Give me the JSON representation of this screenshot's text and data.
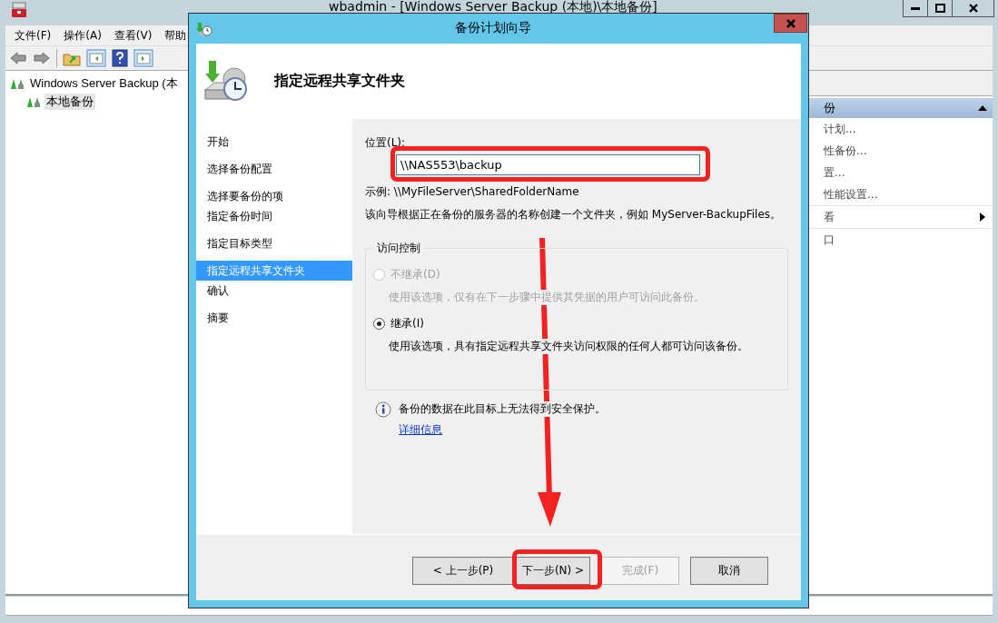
{
  "main_window": {
    "title": "wbadmin - [Windows Server Backup (本地)\\本地备份]",
    "menu": [
      "文件(F)",
      "操作(A)",
      "查看(V)",
      "帮助"
    ],
    "tree": [
      {
        "label": "Windows Server Backup (本",
        "selected": false,
        "children": [
          {
            "label": "本地备份",
            "selected": true
          }
        ]
      }
    ],
    "actions": {
      "header": "份",
      "items": [
        {
          "label": "计划...",
          "kind": "action"
        },
        {
          "label": "性备份...",
          "kind": "action"
        },
        {
          "label": "置...",
          "kind": "action"
        },
        {
          "label": "性能设置...",
          "kind": "action"
        },
        {
          "label": "看",
          "kind": "submenu"
        },
        {
          "label": "口",
          "kind": "action"
        }
      ]
    }
  },
  "dialog": {
    "title": "备份计划向导",
    "heading": "指定远程共享文件夹",
    "steps": [
      {
        "label": "开始",
        "selected": false
      },
      {
        "label": "选择备份配置",
        "selected": false
      },
      {
        "label": "选择要备份的项",
        "selected": false
      },
      {
        "label": "指定备份时间",
        "selected": false
      },
      {
        "label": "指定目标类型",
        "selected": false
      },
      {
        "label": "指定远程共享文件夹",
        "selected": true
      },
      {
        "label": "确认",
        "selected": false
      },
      {
        "label": "摘要",
        "selected": false
      }
    ],
    "location": {
      "label": "位置(L):",
      "value": "\\\\NAS553\\backup"
    },
    "example": "示例: \\\\MyFileServer\\SharedFolderName",
    "description": "该向导根据正在备份的服务器的名称创建一个文件夹，例如 MyServer-BackupFiles。",
    "access_control": {
      "legend": "访问控制",
      "options": [
        {
          "label": "不继承(D)",
          "description": "使用该选项，仅有在下一步骤中提供其凭据的用户可访问此备份。",
          "selected": false,
          "disabled": true
        },
        {
          "label": "继承(I)",
          "description": "使用该选项，具有指定远程共享文件夹访问权限的任何人都可访问该备份。",
          "selected": true,
          "disabled": false
        }
      ]
    },
    "notice": {
      "text": "备份的数据在此目标上无法得到安全保护。",
      "link": "详细信息"
    },
    "buttons": [
      {
        "label": "< 上一步(P)",
        "disabled": false
      },
      {
        "label": "下一步(N) >",
        "disabled": false
      },
      {
        "label": "完成(F)",
        "disabled": true
      },
      {
        "label": "取消",
        "disabled": false
      }
    ]
  }
}
